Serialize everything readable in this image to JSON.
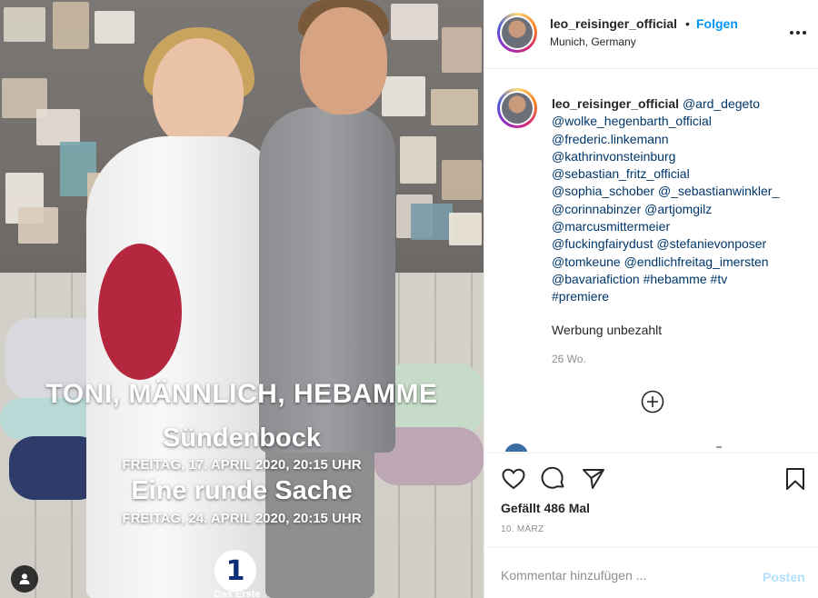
{
  "post": {
    "username": "leo_reisinger_official",
    "follow_label": "Folgen",
    "separator": "•",
    "location": "Munich, Germany"
  },
  "media": {
    "show_title": "TONI, MÄNNLICH, HEBAMME",
    "episode1_title": "Sündenbock",
    "episode1_date": "FREITAG, 17. APRIL 2020, 20:15 UHR",
    "episode2_title": "Eine runde Sache",
    "episode2_date": "FREITAG, 24. APRIL 2020, 20:15 UHR",
    "channel_logo": "1",
    "channel_name": "Das Erste",
    "tag_icon": "user-icon"
  },
  "caption": {
    "username": "leo_reisinger_official",
    "lines": [
      [
        "@ard_degeto"
      ],
      [
        "@wolke_hegenbarth_official"
      ],
      [
        "@frederic.linkemann"
      ],
      [
        "@kathrinvonsteinburg"
      ],
      [
        "@sebastian_fritz_official"
      ],
      [
        "@sophia_schober",
        "@_sebastianwinkler_"
      ],
      [
        "@corinnabinzer",
        "@artjomgilz"
      ],
      [
        "@marcusmittermeier"
      ],
      [
        "@fuckingfairydust",
        "@stefanievonposer"
      ],
      [
        "@tomkeune",
        "@endlichfreitag_imersten"
      ],
      [
        "@bavariafiction",
        "#hebamme",
        "#tv"
      ],
      [
        "#premiere"
      ]
    ],
    "extra": "Werbung unbezahlt",
    "age": "26 Wo."
  },
  "stats": {
    "likes": "Gefällt 486 Mal",
    "date": "10. MÄRZ"
  },
  "comment": {
    "placeholder": "Kommentar hinzufügen ...",
    "post_label": "Posten"
  },
  "colors": {
    "link": "#0095f6",
    "mention": "#00376b",
    "muted": "#8e8e8e",
    "post_disabled": "#b2dffc"
  }
}
